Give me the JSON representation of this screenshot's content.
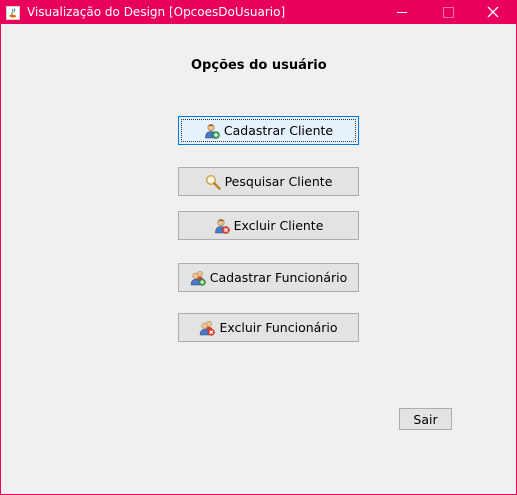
{
  "window": {
    "title": "Visualização do Design [OpcoesDoUsuario]",
    "accent_color": "#e8005a"
  },
  "main": {
    "heading": "Opções do usuário",
    "buttons": [
      {
        "label": "Cadastrar Cliente",
        "icon": "add-user-icon",
        "focused": true
      },
      {
        "label": "Pesquisar Cliente",
        "icon": "search-icon"
      },
      {
        "label": "Excluir Cliente",
        "icon": "remove-user-icon"
      },
      {
        "label": "Cadastrar Funcionário",
        "icon": "add-group-icon"
      },
      {
        "label": "Excluir Funcionário",
        "icon": "remove-group-icon"
      }
    ],
    "exit_label": "Sair"
  }
}
